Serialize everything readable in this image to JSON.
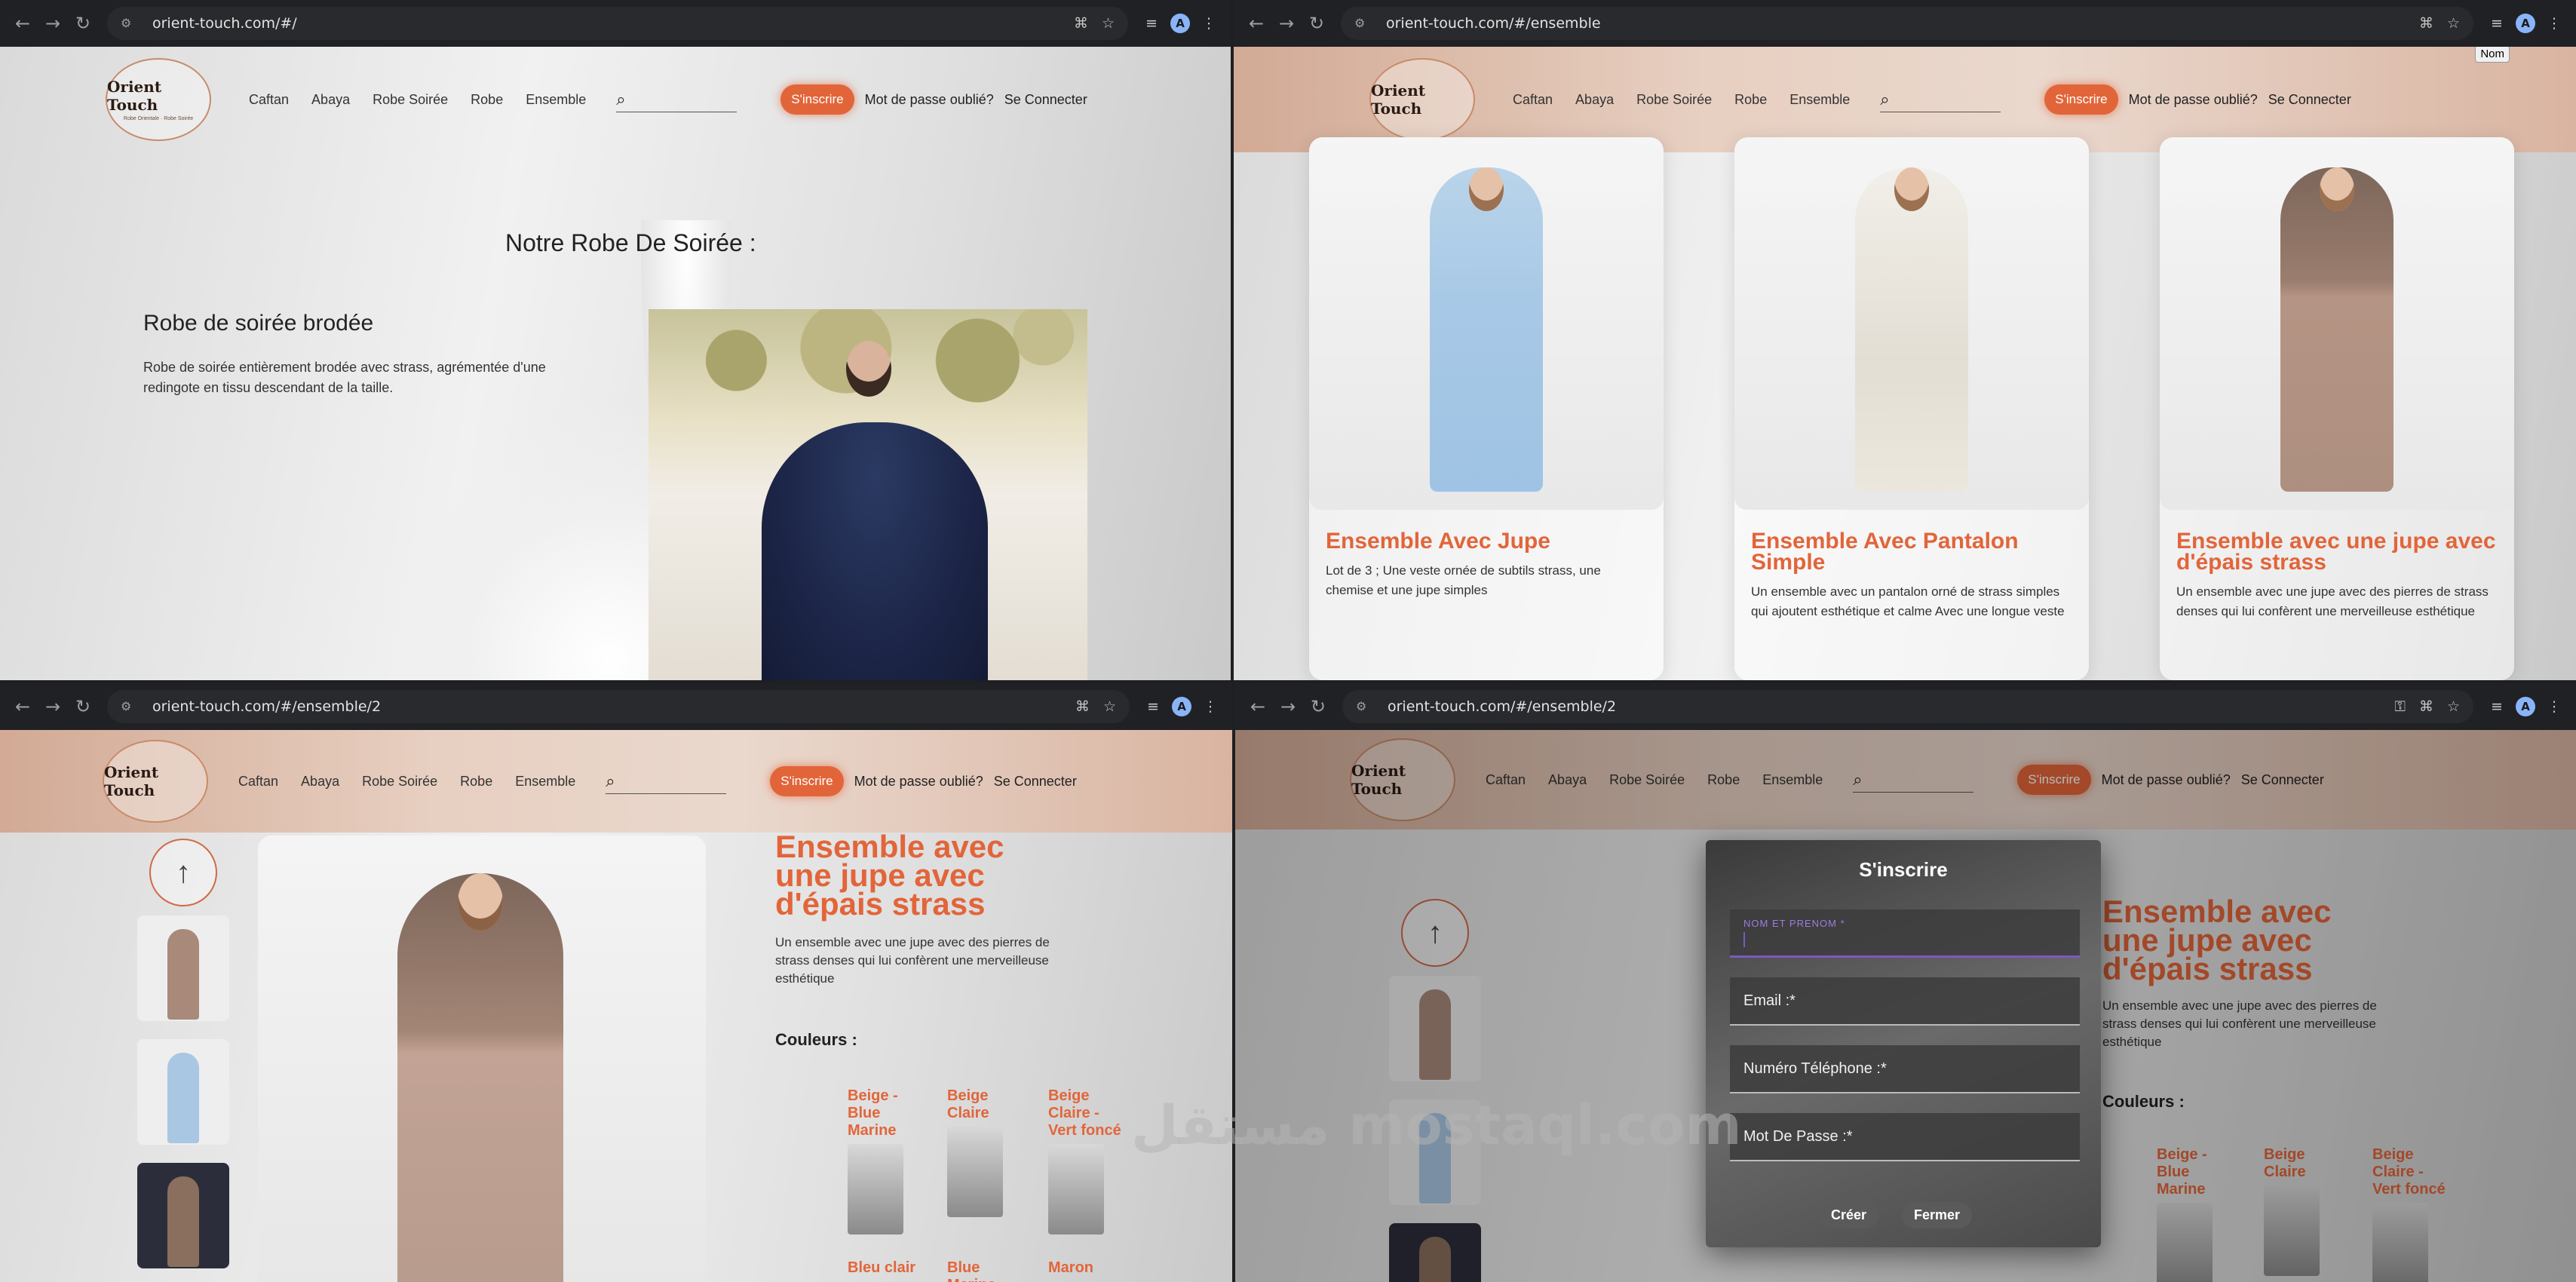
{
  "chrome": {
    "q1_url": "orient-touch.com/#/",
    "q2_url": "orient-touch.com/#/ensemble",
    "q3_url": "orient-touch.com/#/ensemble/2",
    "q4_url": "orient-touch.com/#/ensemble/2",
    "profile_initial": "A"
  },
  "site": {
    "logo_name": "Orient Touch",
    "logo_tagline": "Robe Orientale · Robe Soirée",
    "nav": [
      "Caftan",
      "Abaya",
      "Robe Soirée",
      "Robe",
      "Ensemble"
    ],
    "signup": "S'inscrire",
    "forgot": "Mot de passe oublié?",
    "login": "Se Connecter",
    "sort_label": "Nom"
  },
  "home": {
    "heading": "Notre Robe De Soirée :",
    "product_title": "Robe de soirée brodée",
    "product_desc": "Robe de soirée entièrement brodée avec strass, agrémentée d'une redingote en tissu descendant de la taille."
  },
  "ensemble": {
    "cards": [
      {
        "title": "Ensemble Avec Jupe",
        "desc": "Lot de 3 ; Une veste ornée de subtils strass, une chemise et une jupe simples"
      },
      {
        "title": "Ensemble Avec Pantalon Simple",
        "desc": "Un ensemble avec un pantalon orné de strass simples qui ajoutent esthétique et calme Avec une longue veste"
      },
      {
        "title": "Ensemble avec une jupe avec d'épais strass",
        "desc": "Un ensemble avec une jupe avec des pierres de strass denses qui lui confèrent une merveilleuse esthétique"
      }
    ]
  },
  "detail": {
    "title_lines": [
      "Ensemble avec",
      "une jupe avec",
      "d'épais strass"
    ],
    "desc": "Un ensemble avec une jupe avec des pierres de strass denses qui lui confèrent une merveilleuse esthétique",
    "colors_label": "Couleurs :",
    "arrow": "↑",
    "colors": [
      "Beige - Blue Marine",
      "Beige Claire",
      "Beige Claire - Vert foncé",
      "Bleu clair",
      "Blue Marine",
      "Maron"
    ]
  },
  "modal": {
    "title": "S'inscrire",
    "name_label": "NOM ET PRENOM *",
    "email_label": "Email :*",
    "phone_label": "Numéro Téléphone :*",
    "password_label": "Mot De Passe :*",
    "create": "Créer",
    "close": "Fermer"
  },
  "watermark": "مستقل mostaql.com",
  "colors": {
    "accent": "#e2653a",
    "header_tint": "#d9b4a1",
    "modal_focus": "#7e57c2"
  }
}
